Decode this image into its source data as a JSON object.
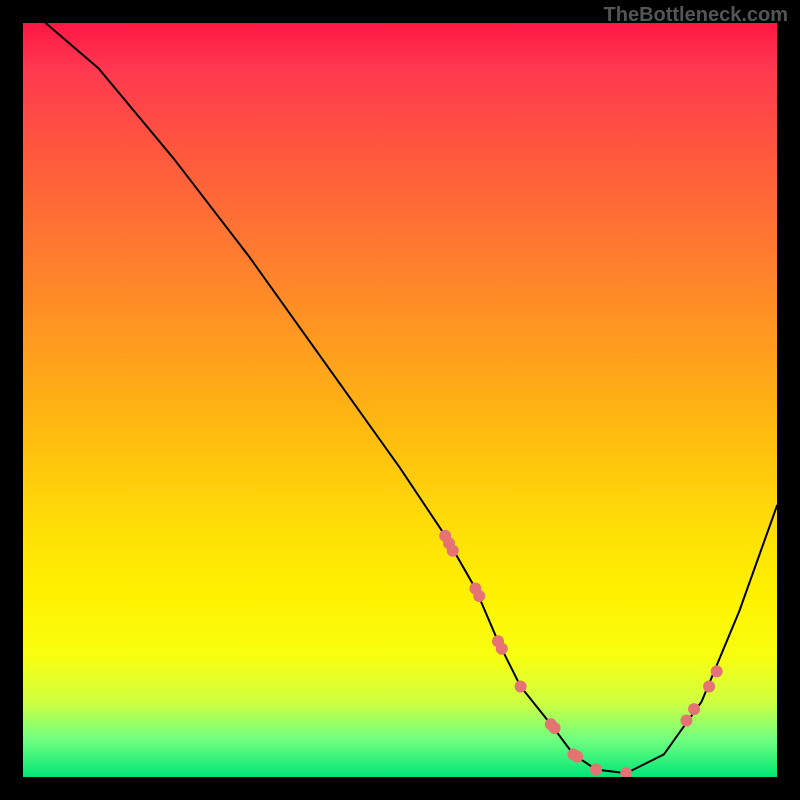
{
  "watermark": "TheBottleneck.com",
  "chart_data": {
    "type": "line",
    "title": "",
    "xlabel": "",
    "ylabel": "",
    "xlim": [
      0,
      100
    ],
    "ylim": [
      0,
      100
    ],
    "curve": {
      "x": [
        3,
        10,
        20,
        30,
        40,
        50,
        56,
        60,
        63,
        66,
        70,
        73,
        76,
        80,
        85,
        90,
        95,
        100
      ],
      "y": [
        100,
        94,
        82,
        69,
        55,
        41,
        32,
        25,
        18,
        12,
        7,
        3,
        1,
        0.5,
        3,
        10,
        22,
        36
      ]
    },
    "markers": {
      "x": [
        56,
        56.5,
        57,
        60,
        60.5,
        63,
        63.5,
        66,
        70,
        70.5,
        73,
        73.5,
        76,
        80,
        88,
        89,
        91,
        92
      ],
      "y": [
        32,
        31,
        30,
        25,
        24,
        18,
        17,
        12,
        7,
        6.5,
        3,
        2.7,
        1,
        0.5,
        7.5,
        9,
        12,
        14
      ]
    },
    "background_gradient": {
      "orientation": "vertical",
      "stops": [
        {
          "pos": 0.0,
          "color": "#ff1744"
        },
        {
          "pos": 0.06,
          "color": "#ff3850"
        },
        {
          "pos": 0.18,
          "color": "#ff5a3c"
        },
        {
          "pos": 0.3,
          "color": "#ff7a30"
        },
        {
          "pos": 0.42,
          "color": "#ff9a20"
        },
        {
          "pos": 0.54,
          "color": "#ffba10"
        },
        {
          "pos": 0.66,
          "color": "#ffdc08"
        },
        {
          "pos": 0.76,
          "color": "#fff200"
        },
        {
          "pos": 0.84,
          "color": "#f8ff10"
        },
        {
          "pos": 0.9,
          "color": "#d0ff40"
        },
        {
          "pos": 0.95,
          "color": "#70ff80"
        },
        {
          "pos": 1.0,
          "color": "#00e676"
        }
      ]
    },
    "marker_color": "#e57373",
    "line_color": "#000000"
  }
}
